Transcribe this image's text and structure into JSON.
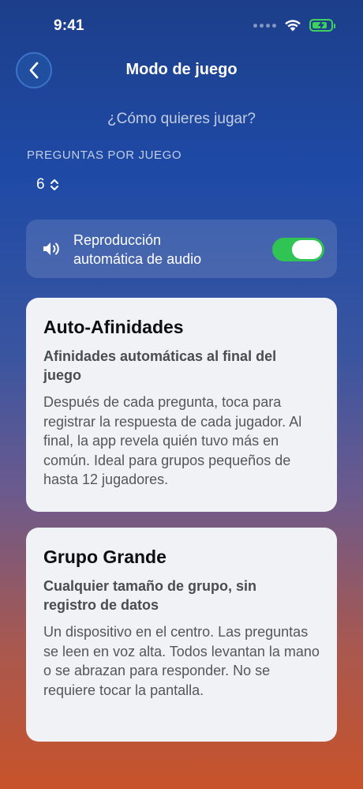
{
  "status_bar": {
    "time": "9:41"
  },
  "nav": {
    "title": "Modo de juego"
  },
  "subtitle": "¿Cómo quieres jugar?",
  "questions": {
    "label": "PREGUNTAS POR JUEGO",
    "value": "6"
  },
  "audio": {
    "label": "Reproducción automática de audio",
    "enabled": true
  },
  "modes": [
    {
      "title": "Auto-Afinidades",
      "subtitle": "Afinidades automáticas al final del juego",
      "description": "Después de cada pregunta, toca para registrar la respuesta de cada jugador. Al final, la app revela quién tuvo más en común. Ideal para grupos pequeños de hasta 12 jugadores."
    },
    {
      "title": "Grupo Grande",
      "subtitle": "Cualquier tamaño de grupo, sin registro de datos",
      "description": "Un dispositivo en el centro. Las preguntas se leen en voz alta. Todos levantan la mano o se abrazan para responder. No se requiere tocar la pantalla."
    }
  ],
  "colors": {
    "accent_green": "#2fc454",
    "card_bg": "#f1f2f6"
  }
}
